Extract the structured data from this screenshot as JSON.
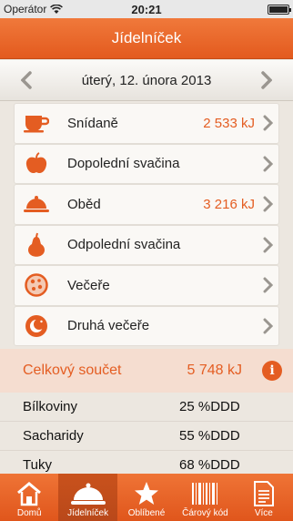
{
  "status": {
    "carrier": "Operátor",
    "time": "20:21"
  },
  "navbar": {
    "title": "Jídelníček"
  },
  "date": {
    "label": "úterý, 12. února 2013"
  },
  "meals": [
    {
      "label": "Snídaně",
      "value": "2 533 kJ",
      "icon": "cup-icon"
    },
    {
      "label": "Dopolední svačina",
      "value": "",
      "icon": "apple-icon"
    },
    {
      "label": "Oběd",
      "value": "3 216 kJ",
      "icon": "cloche-icon"
    },
    {
      "label": "Odpolední svačina",
      "value": "",
      "icon": "pear-icon"
    },
    {
      "label": "Večeře",
      "value": "",
      "icon": "pizza-icon"
    },
    {
      "label": "Druhá večeře",
      "value": "",
      "icon": "moon-icon"
    }
  ],
  "summary": {
    "label": "Celkový součet",
    "value": "5 748 kJ",
    "nutrients": [
      {
        "label": "Bílkoviny",
        "value": "25 %DDD"
      },
      {
        "label": "Sacharidy",
        "value": "55 %DDD"
      },
      {
        "label": "Tuky",
        "value": "68 %DDD"
      }
    ]
  },
  "tabs": [
    {
      "label": "Domů",
      "icon": "house-icon",
      "active": false
    },
    {
      "label": "Jídelníček",
      "icon": "cloche-icon",
      "active": true
    },
    {
      "label": "Oblíbené",
      "icon": "star-icon",
      "active": false
    },
    {
      "label": "Čárový kód",
      "icon": "barcode-icon",
      "active": false
    },
    {
      "label": "Více",
      "icon": "document-icon",
      "active": false
    }
  ],
  "colors": {
    "accent": "#e45d22",
    "navbar": "#e86a2c",
    "summary_bg": "#f5ddd0"
  }
}
